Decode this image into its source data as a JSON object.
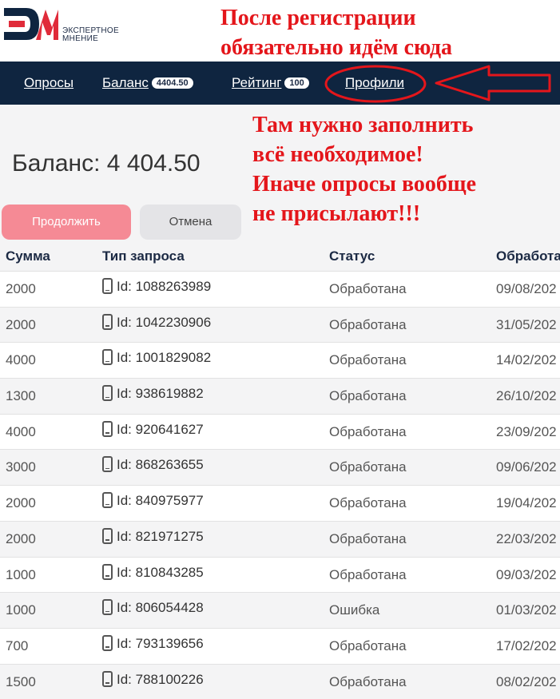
{
  "brand": {
    "logo_text_line1": "ЭКСПЕРТНОЕ",
    "logo_text_line2": "МНЕНИЕ"
  },
  "annotations": {
    "top": "После регистрации\nобязательно идём сюда",
    "side": "Там нужно заполнить\nвсё необходимое!\nИначе опросы вообще\nне присылают!!!",
    "color": "#e4161b"
  },
  "nav": {
    "surveys": "Опросы",
    "balance": "Баланс",
    "balance_badge": "4404.50",
    "rating": "Рейтинг",
    "rating_badge": "100",
    "profiles": "Профили"
  },
  "balance": {
    "label": "Баланс: 4 404.50"
  },
  "buttons": {
    "continue": "Продолжить",
    "cancel": "Отмена"
  },
  "table": {
    "headers": [
      "Сумма",
      "Тип запроса",
      "Статус",
      "Обработа"
    ],
    "rows": [
      {
        "sum": "2000",
        "type": "Id: 1088263989",
        "status": "Обработана",
        "date": "09/08/202"
      },
      {
        "sum": "2000",
        "type": "Id: 1042230906",
        "status": "Обработана",
        "date": "31/05/202"
      },
      {
        "sum": "4000",
        "type": "Id: 1001829082",
        "status": "Обработана",
        "date": "14/02/202"
      },
      {
        "sum": "1300",
        "type": "Id: 938619882",
        "status": "Обработана",
        "date": "26/10/202"
      },
      {
        "sum": "4000",
        "type": "Id: 920641627",
        "status": "Обработана",
        "date": "23/09/202"
      },
      {
        "sum": "3000",
        "type": "Id: 868263655",
        "status": "Обработана",
        "date": "09/06/202"
      },
      {
        "sum": "2000",
        "type": "Id: 840975977",
        "status": "Обработана",
        "date": "19/04/202"
      },
      {
        "sum": "2000",
        "type": "Id: 821971275",
        "status": "Обработана",
        "date": "22/03/202"
      },
      {
        "sum": "1000",
        "type": "Id: 810843285",
        "status": "Обработана",
        "date": "09/03/202"
      },
      {
        "sum": "1000",
        "type": "Id: 806054428",
        "status": "Ошибка",
        "date": "01/03/202"
      },
      {
        "sum": "700",
        "type": "Id: 793139656",
        "status": "Обработана",
        "date": "17/02/202"
      },
      {
        "sum": "1500",
        "type": "Id: 788100226",
        "status": "Обработана",
        "date": "08/02/202"
      }
    ]
  },
  "icons": {
    "row_icon": "phone-icon",
    "arrow": "left-arrow-icon",
    "highlight": "ellipse-highlight"
  }
}
